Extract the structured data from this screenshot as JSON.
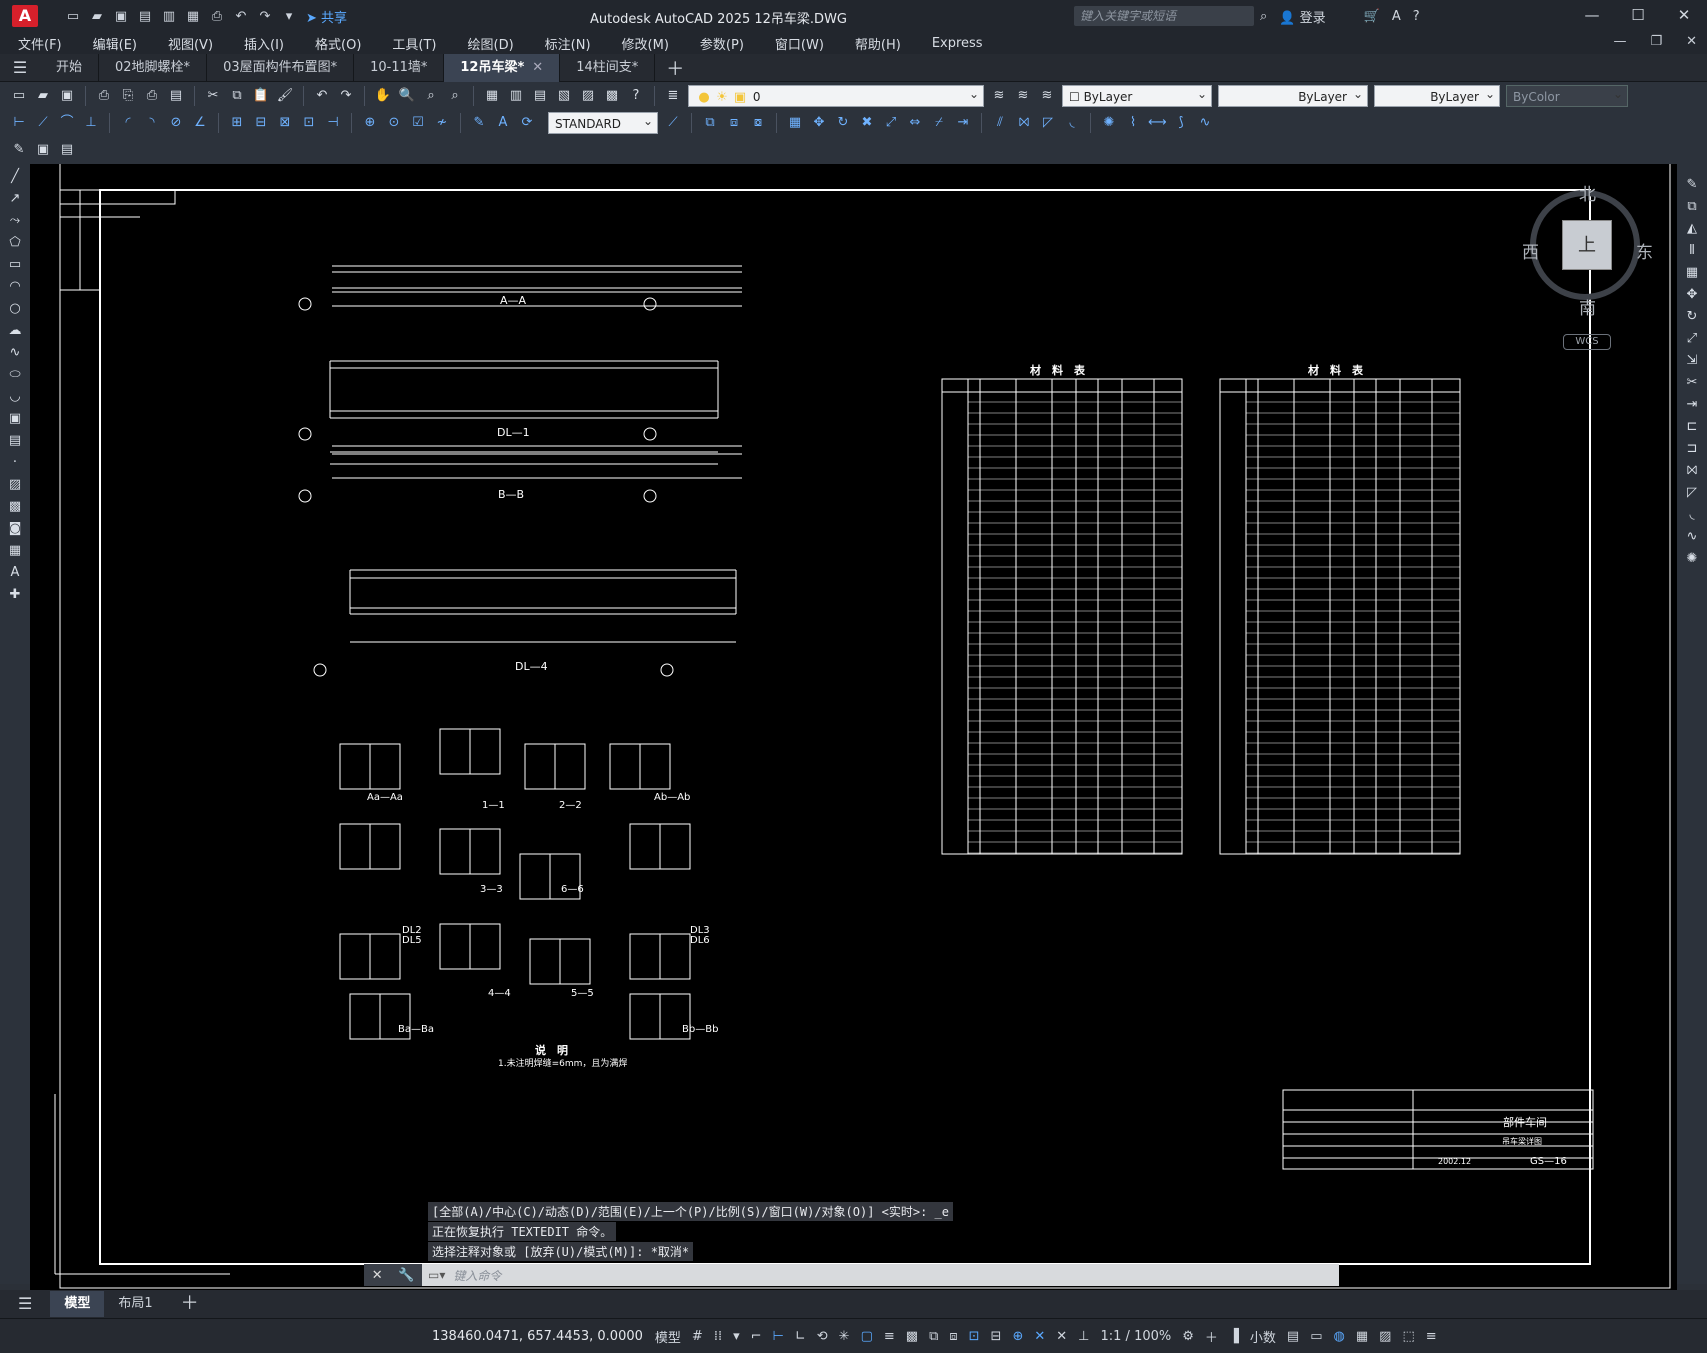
{
  "app": {
    "logo": "A",
    "title": "Autodesk AutoCAD 2025    12吊车梁.DWG",
    "share_label": "共享",
    "search_placeholder": "键入关键字或短语",
    "login_label": "登录"
  },
  "menu": [
    "文件(F)",
    "编辑(E)",
    "视图(V)",
    "插入(I)",
    "格式(O)",
    "工具(T)",
    "绘图(D)",
    "标注(N)",
    "修改(M)",
    "参数(P)",
    "窗口(W)",
    "帮助(H)",
    "Express"
  ],
  "tabs": [
    {
      "label": "开始"
    },
    {
      "label": "02地脚螺栓*"
    },
    {
      "label": "03屋面构件布置图*"
    },
    {
      "label": "10-11墙*"
    },
    {
      "label": "12吊车梁*",
      "active": true
    },
    {
      "label": "14柱间支*"
    }
  ],
  "toolbar": {
    "layer_value": "0",
    "color_value": "ByLayer",
    "linetype_value": "ByLayer",
    "lineweight_value": "ByLayer",
    "plotstyle_value": "ByColor",
    "textstyle_value": "STANDARD"
  },
  "drawing": {
    "section_aa": "A—A",
    "dl1": "DL—1",
    "section_bb": "B—B",
    "dl4": "DL—4",
    "detail_labels": [
      "Aa—Aa",
      "1—1",
      "2—2",
      "Ab—Ab",
      "3—3",
      "6—6",
      "4—4",
      "5—5",
      "Ba—Ba",
      "Bb—Bb"
    ],
    "dl_labels_left": [
      "DL2",
      "DL5"
    ],
    "dl_labels_right": [
      "DL3",
      "DL6"
    ],
    "note_title": "说　明",
    "note_text": "1.未注明焊缝=6mm，且为满焊",
    "mtable_title_1": "材　料　表",
    "mtable_title_2": "材　料　表",
    "title_block_project": "部件车间",
    "title_block_drawing": "吊车梁详图",
    "title_block_no": "GS—16",
    "title_block_date": "2002.12"
  },
  "viewcube": {
    "north": "北",
    "south": "南",
    "west": "西",
    "east": "东",
    "face": "上",
    "wcs": "WCS"
  },
  "command": {
    "history": [
      "[全部(A)/中心(C)/动态(D)/范围(E)/上一个(P)/比例(S)/窗口(W)/对象(O)] <实时>: _e",
      "正在恢复执行 TEXTEDIT 命令。",
      "选择注释对象或 [放弃(U)/模式(M)]: *取消*"
    ],
    "placeholder": "键入命令"
  },
  "layout_tabs": [
    {
      "label": "模型",
      "active": true
    },
    {
      "label": "布局1"
    }
  ],
  "status": {
    "coords": "138460.0471, 657.4453, 0.0000",
    "model_label": "模型",
    "scale": "1:1 / 100%",
    "units": "小数"
  }
}
